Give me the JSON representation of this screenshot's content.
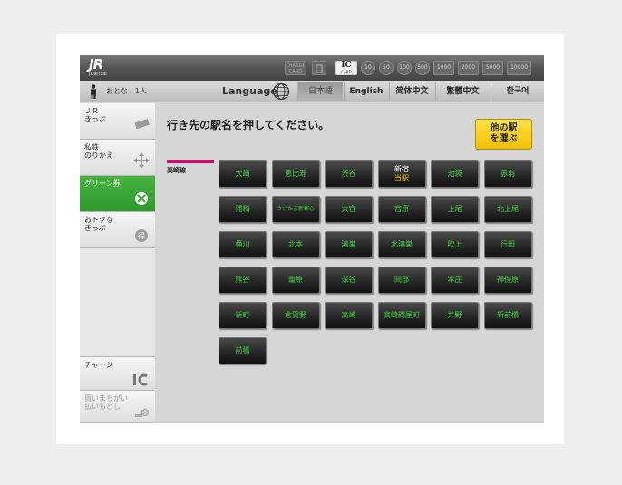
{
  "logo": {
    "text": "JR",
    "sub": "JR東日本"
  },
  "payment": {
    "charge_label": "CHARGE CARD",
    "ic_label": "IC",
    "ic_sub": "CARD",
    "coins": [
      "10",
      "50",
      "100",
      "500"
    ],
    "bills": [
      "1000",
      "2000",
      "5000",
      "10000"
    ]
  },
  "passengers": {
    "label": "おとな　1人"
  },
  "language": {
    "label": "Language",
    "options": [
      "日本語",
      "English",
      "简体中文",
      "繁體中文",
      "한국어"
    ],
    "selected": "日本語"
  },
  "sidebar": {
    "items": [
      {
        "label": "ＪＲ\nきっぷ",
        "icon": "ticket-icon"
      },
      {
        "label": "私鉄\nのりかえ",
        "icon": "transfer-arrows-icon"
      },
      {
        "label": "グリーン券",
        "icon": "green-car-icon",
        "active": true
      },
      {
        "label": "おトクな\nきっぷ",
        "icon": "discount-icon"
      },
      {
        "label": "チャージ",
        "icon": "ic-charge-icon"
      },
      {
        "label": "買いまちがい\n払いもどし",
        "icon": "refund-icon",
        "dim": true
      }
    ]
  },
  "main": {
    "prompt": "行き先の駅名を押してください。",
    "other_button": "他の駅\nを選ぶ",
    "line_label": "高崎線",
    "current_station": {
      "name": "新宿",
      "tag": "当駅"
    },
    "stations": [
      "大崎",
      "恵比寿",
      "渋谷",
      "新宿",
      "池袋",
      "赤羽",
      "浦和",
      "さいたま新都心",
      "大宮",
      "宮原",
      "上尾",
      "北上尾",
      "桶川",
      "北本",
      "鴻巣",
      "北鴻巣",
      "吹上",
      "行田",
      "熊谷",
      "籠原",
      "深谷",
      "岡部",
      "本庄",
      "神保原",
      "新町",
      "倉賀野",
      "高崎",
      "高崎問屋町",
      "井野",
      "新前橋",
      "前橋"
    ]
  },
  "colors": {
    "accent_green": "#3cd43c",
    "active_tab": "#3aa836",
    "line_color": "#e0007a",
    "other_button": "#f8d21c"
  }
}
